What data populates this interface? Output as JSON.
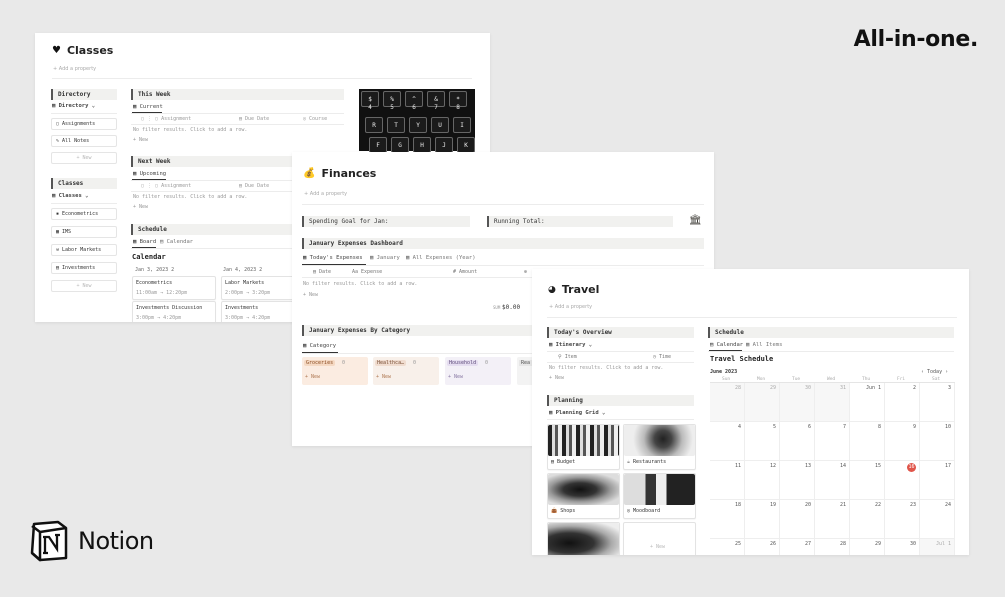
{
  "headline": "All-in-one.",
  "brand": {
    "name": "Notion",
    "logo_icon": "notion-logo-icon"
  },
  "classes": {
    "title": "Classes",
    "icon": "black-heart-icon",
    "add_property": "Add a property",
    "directory_header": "Directory",
    "directory_view": "Directory",
    "directory_items": [
      "Assignments",
      "All Notes"
    ],
    "new_label": "New",
    "classes_header": "Classes",
    "classes_view": "Classes",
    "class_items": [
      "Econometrics",
      "IMS",
      "Labor Markets",
      "Investments"
    ],
    "this_week": {
      "header": "This Week",
      "tab": "Current",
      "cols": [
        "Assignment",
        "Due Date",
        "Course"
      ],
      "empty": "No filter results. Click to add a row.",
      "new": "New"
    },
    "next_week": {
      "header": "Next Week",
      "tab": "Upcoming",
      "cols": [
        "Assignment",
        "Due Date"
      ],
      "empty": "No filter results. Click to add a row.",
      "new": "New"
    },
    "schedule": {
      "header": "Schedule",
      "tabs": [
        "Board",
        "Calendar"
      ],
      "title": "Calendar",
      "col1": {
        "date": "Jan 3, 2023",
        "count": "2",
        "events": [
          {
            "name": "Econometrics",
            "time": "11:00am → 12:20pm"
          },
          {
            "name": "Investments Discussion",
            "time": "3:00pm → 4:20pm"
          }
        ]
      },
      "col2": {
        "date": "Jan 4, 2023",
        "count": "2",
        "events": [
          {
            "name": "Labor Markets",
            "time": "2:00pm → 3:20pm"
          },
          {
            "name": "Investments",
            "time": "3:00pm → 4:20pm"
          }
        ]
      }
    },
    "keyboard_keys": [
      "$",
      "%",
      "^",
      "&",
      "*",
      "4",
      "5",
      "6",
      "7",
      "8",
      "R",
      "T",
      "Y",
      "U",
      "I",
      "F",
      "G",
      "H",
      "J",
      "K"
    ]
  },
  "finances": {
    "title": "Finances",
    "icon": "moneybag-icon",
    "add_property": "Add a property",
    "spending_goal": "Spending Goal for Jan:",
    "running_total": "Running Total:",
    "dashboard_header": "January Expenses Dashboard",
    "tabs": [
      "Today's Expenses",
      "January",
      "All Expenses (Year)"
    ],
    "cols": [
      "Date",
      "Expense",
      "Amount"
    ],
    "empty": "No filter results. Click to add a row.",
    "new": "New",
    "sum_label": "SUM",
    "sum_value": "$0.00",
    "category_header": "January Expenses By Category",
    "category_tab": "Category",
    "categories": [
      {
        "name": "Groceries",
        "count": "0",
        "bg": "#fbece1",
        "tag": "#f5d9c3"
      },
      {
        "name": "Healthca…",
        "count": "0",
        "bg": "#f8f0ea",
        "tag": "#f0dccf"
      },
      {
        "name": "Household",
        "count": "0",
        "bg": "#f3f0f7",
        "tag": "#e5ddf0"
      },
      {
        "name": "Rea",
        "count": "",
        "bg": "#f3f3f3",
        "tag": "#e6e6e6"
      }
    ],
    "cat_new": "New"
  },
  "travel": {
    "title": "Travel",
    "icon": "globe-icon",
    "add_property": "Add a property",
    "overview_header": "Today's Overview",
    "overview_view": "Itinerary",
    "overview_cols": [
      "Item",
      "Time"
    ],
    "empty": "No filter results. Click to add a row.",
    "new": "New",
    "planning_header": "Planning",
    "planning_view": "Planning Grid",
    "planning_items": [
      "Budget",
      "Restaurants",
      "Shops",
      "Moodboard"
    ],
    "schedule_header": "Schedule",
    "schedule_tabs": [
      "Calendar",
      "All Items"
    ],
    "schedule_title": "Travel Schedule",
    "month": "June 2023",
    "today_label": "Today",
    "dows": [
      "Sun",
      "Mon",
      "Tue",
      "Wed",
      "Thu",
      "Fri",
      "Sat"
    ],
    "weeks": [
      [
        "28",
        "29",
        "30",
        "31",
        "Jun 1",
        "2",
        "3"
      ],
      [
        "4",
        "5",
        "6",
        "7",
        "8",
        "9",
        "10"
      ],
      [
        "11",
        "12",
        "13",
        "14",
        "15",
        "16",
        "17"
      ],
      [
        "18",
        "19",
        "20",
        "21",
        "22",
        "23",
        "24"
      ],
      [
        "25",
        "26",
        "27",
        "28",
        "29",
        "30",
        "Jul 1"
      ]
    ],
    "today_day": "16"
  }
}
